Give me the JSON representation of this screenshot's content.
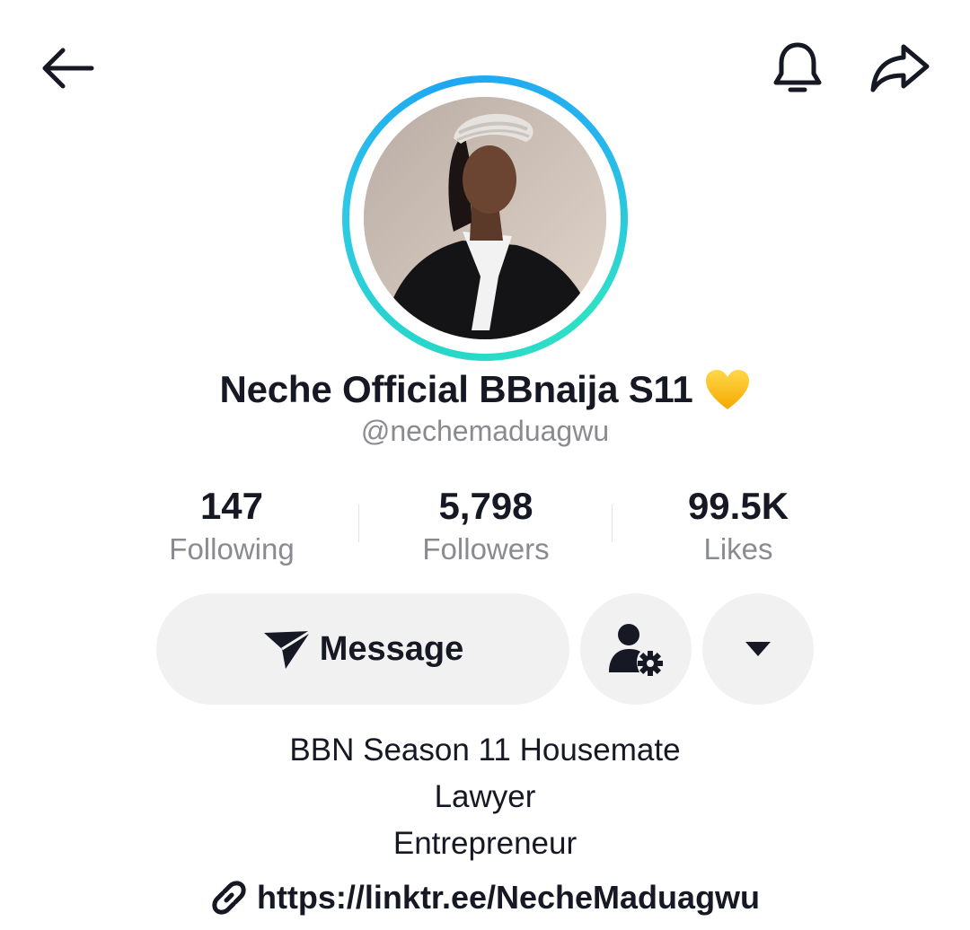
{
  "header": {
    "back_icon": "arrow-left-icon",
    "bell_icon": "bell-icon",
    "share_icon": "share-arrow-icon"
  },
  "profile": {
    "display_name": "Neche Official BBnaija S11",
    "name_emoji": "💛",
    "handle": "@nechemaduagwu",
    "ring_colors": [
      "#1ea6f2",
      "#2fe0c7"
    ]
  },
  "stats": [
    {
      "value": "147",
      "label": "Following"
    },
    {
      "value": "5,798",
      "label": "Followers"
    },
    {
      "value": "99.5K",
      "label": "Likes"
    }
  ],
  "actions": {
    "message_label": "Message",
    "message_icon": "paper-plane-icon",
    "suggest_icon": "user-gear-icon",
    "more_icon": "caret-down-icon"
  },
  "bio": {
    "lines": [
      "BBN Season 11 Housemate",
      "Lawyer",
      "Entrepreneur"
    ],
    "link_icon": "link-icon",
    "link": "https://linktr.ee/NecheMaduagwu"
  }
}
